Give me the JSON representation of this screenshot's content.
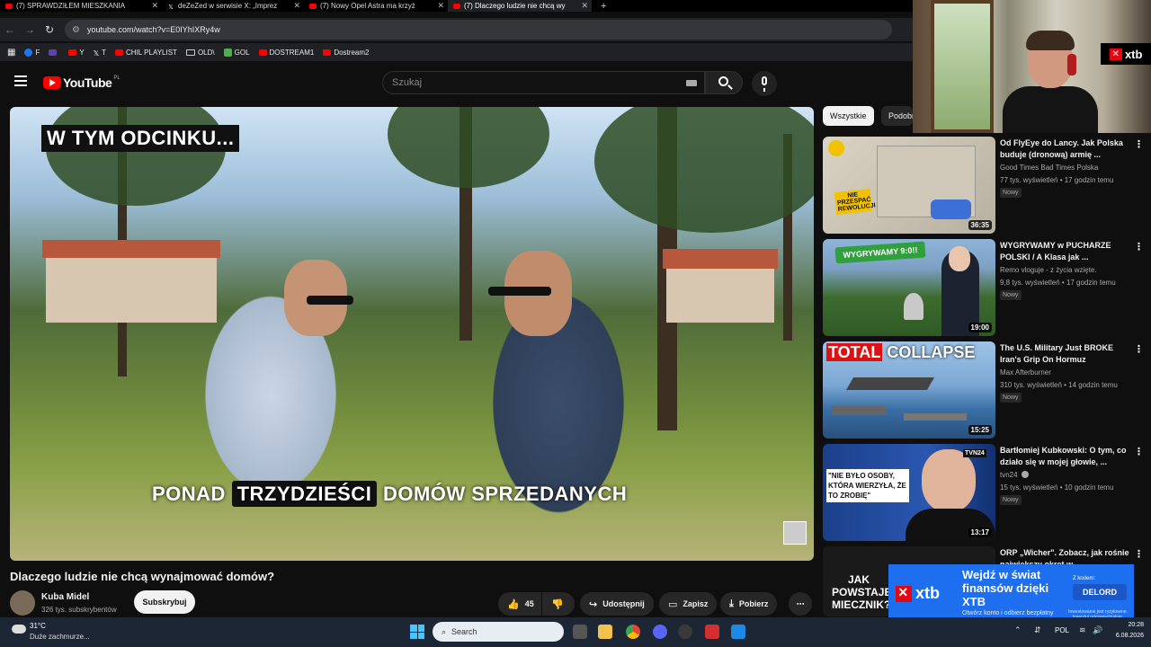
{
  "browser": {
    "tabs": [
      {
        "title": "(7) SPRAWDZIŁEM MIESZKANIA",
        "icon": "youtube-icon"
      },
      {
        "title": "deZeZed w serwisie X: „Imprez",
        "icon": "x-icon"
      },
      {
        "title": "(7) Nowy Opel Astra ma krzyż",
        "icon": "youtube-icon"
      },
      {
        "title": "(7) Dlaczego ludzie nie chcą wy",
        "icon": "youtube-icon"
      }
    ],
    "new_tab": "+",
    "url": "youtube.com/watch?v=E0IYhIXRy4w",
    "bookmarks": [
      {
        "label": "F",
        "icon": "facebook-icon"
      },
      {
        "label": "",
        "icon": "twitch-icon"
      },
      {
        "label": "Y",
        "icon": "youtube-icon"
      },
      {
        "label": "T",
        "icon": "x-icon"
      },
      {
        "label": "CHIL PLAYLIST",
        "icon": "youtube-icon"
      },
      {
        "label": "OLD\\",
        "icon": "folder-icon"
      },
      {
        "label": "GOL",
        "icon": "g-icon"
      },
      {
        "label": "DOSTREAM1",
        "icon": "youtube-icon"
      },
      {
        "label": "Dostream2",
        "icon": "youtube-icon"
      }
    ]
  },
  "youtube": {
    "logo": "YouTube",
    "country": "PL",
    "search_placeholder": "Szukaj"
  },
  "video": {
    "banner": "W TYM ODCINKU...",
    "subtitle_before": "PONAD",
    "subtitle_highlight": "TRZYDZIEŚCI",
    "subtitle_after": "DOMÓW  SPRZEDANYCH",
    "title": "Dlaczego ludzie nie chcą wynajmować domów?",
    "channel": "Kuba Midel",
    "subscribers": "326 tys. subskrybentów",
    "subscribe_label": "Subskrybuj",
    "likes": "45",
    "share_label": "Udostępnij",
    "save_label": "Zapisz",
    "download_label": "Pobierz"
  },
  "chips": {
    "all": "Wszystkie",
    "similar": "Podobne"
  },
  "recommended": [
    {
      "title": "Od FlyEye do Lancy. Jak Polska buduje (dronową) armię ...",
      "channel": "Good Times Bad Times Polska",
      "meta": "77 tys. wyświetleń • 17 godzin temu",
      "badge": "Nowy",
      "duration": "36:35",
      "thumb_text": "NIE PRZESPAĆ REWOLUCJI"
    },
    {
      "title": "WYGRYWAMY w PUCHARZE POLSKI / A Klasa jak ...",
      "channel": "Remo vloguje - z życia wzięte.",
      "meta": "9,8 tys. wyświetleń • 17 godzin temu",
      "badge": "Nowy",
      "duration": "19:00",
      "thumb_text": "WYGRYWAMY 9:0!!"
    },
    {
      "title": "The U.S. Military Just BROKE Iran's Grip On Hormuz",
      "channel": "Max Afterburner",
      "meta": "310 tys. wyświetleń • 14 godzin temu",
      "badge": "Nowy",
      "duration": "15:25",
      "thumb_text_red": "TOTAL",
      "thumb_text_white": "COLLAPSE"
    },
    {
      "title": "Bartłomiej Kubkowski: O tym, co działo się w mojej głowie, ...",
      "channel": "tvn24",
      "meta": "15 tys. wyświetleń • 10 godzin temu",
      "badge": "Nowy",
      "duration": "13:17",
      "thumb_text": "\"NIE BYŁO OSOBY, KTÓRA WIERZYŁA, ŻE TO ZROBIĘ\"",
      "thumb_badge": "TVN24"
    },
    {
      "title": "ORP „Wicher\". Zobacz, jak rośnie największy okręt w ...",
      "thumb_text": "JAK POWSTAJE MIECZNIK?"
    }
  ],
  "ad": {
    "brand": "xtb",
    "headline": "Wejdź w świat finansów dzięki XTB",
    "sub": "Otwórz konto i odbierz bezpłatny kurs",
    "code_label": "Z kodem:",
    "code": "DELORD",
    "disclaimer": "Inwestowanie jest ryzykowne. Inwestuj odpowiedzialnie."
  },
  "webcam": {
    "overlay_brand": "xtb"
  },
  "taskbar": {
    "temp": "31°C",
    "weather": "Duże zachmurze...",
    "search": "Search",
    "lang": "POL",
    "time": "20:28",
    "date": "6.08.2026"
  }
}
